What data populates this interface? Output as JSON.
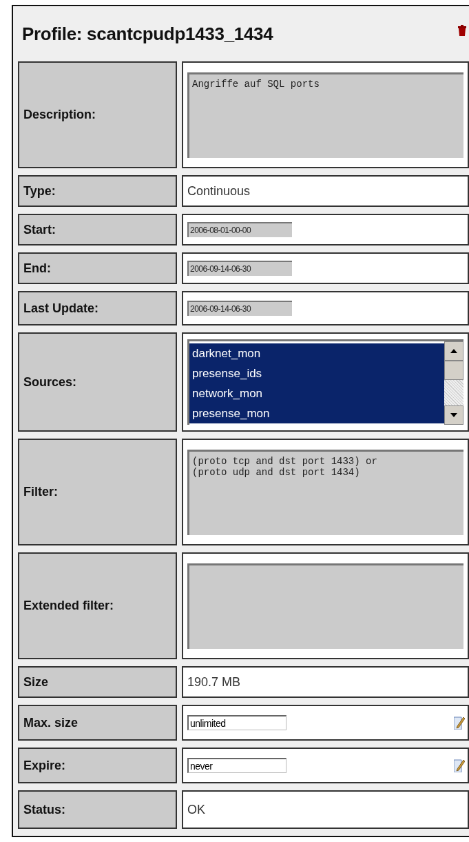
{
  "title": "Profile: scantcpudp1433_1434",
  "rows": [
    {
      "kind": "textarea",
      "label": "Description:",
      "value": "Angriffe auf SQL ports"
    },
    {
      "kind": "text",
      "label": "Type:",
      "value": "Continuous"
    },
    {
      "kind": "readonly",
      "label": "Start:",
      "value": "2006-08-01-00-00"
    },
    {
      "kind": "readonly",
      "label": "End:",
      "value": "2006-09-14-06-30"
    },
    {
      "kind": "readonly",
      "label": "Last Update:",
      "value": "2006-09-14-06-30"
    },
    {
      "kind": "listbox",
      "label": "Sources:",
      "options": [
        {
          "text": "darknet_mon",
          "selected": true
        },
        {
          "text": "presense_ids",
          "selected": true
        },
        {
          "text": "network_mon",
          "selected": true
        },
        {
          "text": "presense_mon",
          "selected": true
        }
      ]
    },
    {
      "kind": "textarea",
      "label": "Filter:",
      "value": "(proto tcp and dst port 1433) or\n(proto udp and dst port 1434)"
    },
    {
      "kind": "textarea",
      "label": "Extended filter:"
    },
    {
      "kind": "text",
      "label": "Size",
      "value": "190.7 MB"
    },
    {
      "kind": "editable",
      "label": "Max. size",
      "value": "unlimited"
    },
    {
      "kind": "editable",
      "label": "Expire:",
      "value": "never"
    },
    {
      "kind": "text",
      "label": "Status:",
      "value": "OK"
    }
  ]
}
